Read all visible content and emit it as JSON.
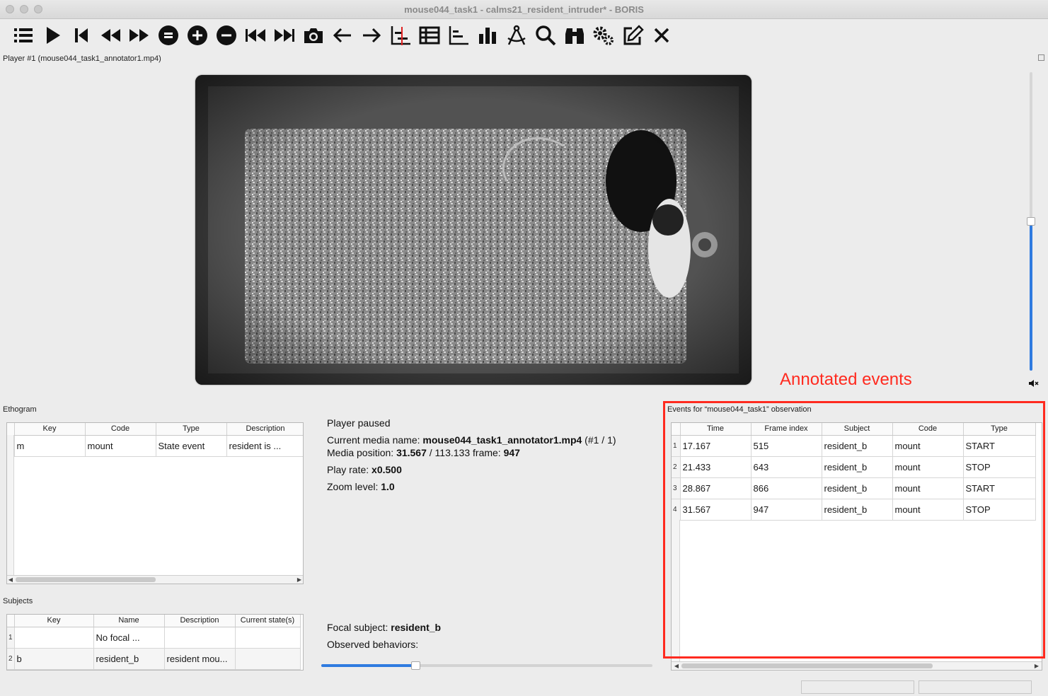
{
  "window": {
    "title": "mouse044_task1 - calms21_resident_intruder* - BORIS"
  },
  "toolbar": {
    "buttons": [
      "menu-list",
      "play",
      "skip-previous",
      "fast-rewind",
      "fast-forward",
      "reset-speed",
      "speed-up",
      "speed-down",
      "previous-media",
      "next-media",
      "snapshot",
      "jump-backward",
      "jump-forward",
      "plot-events",
      "subjects-table",
      "plot-time-budget",
      "bar-chart",
      "measure-tool",
      "search",
      "find-replace",
      "preferences",
      "edit-event",
      "close-observation"
    ]
  },
  "player": {
    "label": "Player #1 (mouse044_task1_annotator1.mp4)"
  },
  "ethogram": {
    "label": "Ethogram",
    "columns": [
      "Key",
      "Code",
      "Type",
      "Description"
    ],
    "rows": [
      {
        "num": "1",
        "key": "m",
        "code": "mount",
        "type": "State event",
        "description": "resident is ..."
      }
    ]
  },
  "subjects": {
    "label": "Subjects",
    "columns": [
      "Key",
      "Name",
      "Description",
      "Current state(s)"
    ],
    "rows": [
      {
        "num": "1",
        "key": "",
        "name": "No focal ...",
        "description": "",
        "state": ""
      },
      {
        "num": "2",
        "key": "b",
        "name": "resident_b",
        "description": "resident mou...",
        "state": ""
      }
    ]
  },
  "status": {
    "player_state": "Player paused",
    "media_name_label": "Current media name: ",
    "media_name": "mouse044_task1_annotator1.mp4",
    "media_count": " (#1 / 1)",
    "position_label": "Media position: ",
    "position": "31.567",
    "duration": " / 113.133 frame: ",
    "frame": "947",
    "rate_label": "Play rate: ",
    "rate": "x0.500",
    "zoom_label": "Zoom level: ",
    "zoom": "1.0",
    "focal_label": "Focal subject: ",
    "focal": "resident_b",
    "observed_label": "Observed behaviors:"
  },
  "events": {
    "label": "Events for “mouse044_task1” observation",
    "columns": [
      "Time",
      "Frame index",
      "Subject",
      "Code",
      "Type"
    ],
    "rows": [
      {
        "num": "1",
        "time": "17.167",
        "frame": "515",
        "subject": "resident_b",
        "code": "mount",
        "type": "START"
      },
      {
        "num": "2",
        "time": "21.433",
        "frame": "643",
        "subject": "resident_b",
        "code": "mount",
        "type": "STOP"
      },
      {
        "num": "3",
        "time": "28.867",
        "frame": "866",
        "subject": "resident_b",
        "code": "mount",
        "type": "START"
      },
      {
        "num": "4",
        "time": "31.567",
        "frame": "947",
        "subject": "resident_b",
        "code": "mount",
        "type": "STOP"
      }
    ]
  },
  "annotation": {
    "text": "Annotated events",
    "color": "#ff2a1f"
  },
  "slider": {
    "position_fraction": 0.28
  },
  "volume": {
    "level_fraction": 0.5
  }
}
